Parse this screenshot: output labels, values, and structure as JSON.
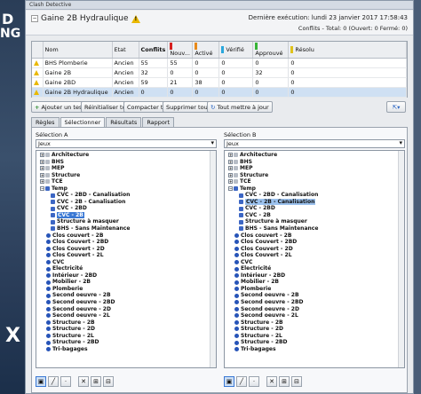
{
  "window": {
    "title": "Clash Detective"
  },
  "background": {
    "left_text_1": "D",
    "left_text_2": "NG",
    "left_text_3": "X"
  },
  "header": {
    "test_name": "Gaine 2B Hydraulique",
    "last_run_label": "Dernière exécution:",
    "last_run_value": "lundi 23 janvier 2017 17:58:43",
    "counts": "Conflits - Total: 0 (Ouvert: 0 Fermé: 0)"
  },
  "grid": {
    "columns": [
      "Nom",
      "Etat",
      "Conflits",
      "Nouv...",
      "Activé",
      "Vérifié",
      "Approuvé",
      "Résolu"
    ],
    "column_colors": [
      "",
      "",
      "",
      "#d62020",
      "#e88a1a",
      "#2aa7dc",
      "#37b437",
      "#e0c21a"
    ],
    "rows": [
      {
        "name": "BHS Plomberie",
        "state": "Ancien",
        "conflicts": "55",
        "new": "55",
        "active": "0",
        "verified": "0",
        "approved": "0",
        "resolved": "0"
      },
      {
        "name": "Gaine 2B",
        "state": "Ancien",
        "conflicts": "32",
        "new": "0",
        "active": "0",
        "verified": "0",
        "approved": "32",
        "resolved": "0"
      },
      {
        "name": "Gaine 2BD",
        "state": "Ancien",
        "conflicts": "59",
        "new": "21",
        "active": "38",
        "verified": "0",
        "approved": "0",
        "resolved": "0"
      },
      {
        "name": "Gaine 2B Hydraulique",
        "state": "Ancien",
        "conflicts": "0",
        "new": "0",
        "active": "0",
        "verified": "0",
        "approved": "0",
        "resolved": "0"
      }
    ]
  },
  "buttons": {
    "add_test": "Ajouter un test",
    "reset_all": "Réinitialiser tout",
    "compact_all": "Compacter tout",
    "delete_all": "Supprimer tout",
    "update_all": "Tout mettre à jour"
  },
  "tabs": [
    "Règles",
    "Sélectionner",
    "Résultats",
    "Rapport"
  ],
  "selection_a": {
    "label": "Sélection A",
    "combo": "Jeux",
    "items": [
      {
        "label": "Architecture",
        "indent": 0,
        "type": "folder",
        "state": ""
      },
      {
        "label": "BHS",
        "indent": 0,
        "type": "folder",
        "state": ""
      },
      {
        "label": "MEP",
        "indent": 0,
        "type": "folder",
        "state": ""
      },
      {
        "label": "Structure",
        "indent": 0,
        "type": "folder",
        "state": ""
      },
      {
        "label": "TCE",
        "indent": 0,
        "type": "folder",
        "state": ""
      },
      {
        "label": "Temp",
        "indent": 0,
        "type": "set",
        "state": ""
      },
      {
        "label": "CVC - 2BD - Canalisation",
        "indent": 1,
        "type": "set",
        "state": ""
      },
      {
        "label": "CVC - 2B - Canalisation",
        "indent": 1,
        "type": "set",
        "state": ""
      },
      {
        "label": "CVC - 2BD",
        "indent": 1,
        "type": "set",
        "state": ""
      },
      {
        "label": "CVC - 2B",
        "indent": 1,
        "type": "set",
        "state": "selected"
      },
      {
        "label": "Structure à masquer",
        "indent": 1,
        "type": "set",
        "state": ""
      },
      {
        "label": "BHS - Sans Maintenance",
        "indent": 1,
        "type": "set",
        "state": ""
      },
      {
        "label": "Clos couvert - 2B",
        "indent": 0,
        "type": "dot",
        "state": ""
      },
      {
        "label": "Clos Couvert - 2BD",
        "indent": 0,
        "type": "dot",
        "state": ""
      },
      {
        "label": "Clos Couvert - 2D",
        "indent": 0,
        "type": "dot",
        "state": ""
      },
      {
        "label": "Clos Couvert - 2L",
        "indent": 0,
        "type": "dot",
        "state": ""
      },
      {
        "label": "CVC",
        "indent": 0,
        "type": "dot",
        "state": ""
      },
      {
        "label": "Electricité",
        "indent": 0,
        "type": "dot",
        "state": ""
      },
      {
        "label": "Intérieur - 2BD",
        "indent": 0,
        "type": "dot",
        "state": ""
      },
      {
        "label": "Mobilier - 2B",
        "indent": 0,
        "type": "dot",
        "state": ""
      },
      {
        "label": "Plomberie",
        "indent": 0,
        "type": "dot",
        "state": ""
      },
      {
        "label": "Second oeuvre - 2B",
        "indent": 0,
        "type": "dot",
        "state": ""
      },
      {
        "label": "Second oeuvre - 2BD",
        "indent": 0,
        "type": "dot",
        "state": ""
      },
      {
        "label": "Second oeuvre - 2D",
        "indent": 0,
        "type": "dot",
        "state": ""
      },
      {
        "label": "Second oeuvre - 2L",
        "indent": 0,
        "type": "dot",
        "state": ""
      },
      {
        "label": "Structure - 2B",
        "indent": 0,
        "type": "dot",
        "state": ""
      },
      {
        "label": "Structure - 2D",
        "indent": 0,
        "type": "dot",
        "state": ""
      },
      {
        "label": "Structure - 2L",
        "indent": 0,
        "type": "dot",
        "state": ""
      },
      {
        "label": "Structure - 2BD",
        "indent": 0,
        "type": "dot",
        "state": ""
      },
      {
        "label": "Tri-bagages",
        "indent": 0,
        "type": "dot",
        "state": ""
      }
    ]
  },
  "selection_b": {
    "label": "Sélection B",
    "combo": "Jeux",
    "items": [
      {
        "label": "Architecture",
        "indent": 0,
        "type": "folder",
        "state": ""
      },
      {
        "label": "BHS",
        "indent": 0,
        "type": "folder",
        "state": ""
      },
      {
        "label": "MEP",
        "indent": 0,
        "type": "folder",
        "state": ""
      },
      {
        "label": "Structure",
        "indent": 0,
        "type": "folder",
        "state": ""
      },
      {
        "label": "TCE",
        "indent": 0,
        "type": "folder",
        "state": ""
      },
      {
        "label": "Temp",
        "indent": 0,
        "type": "set",
        "state": ""
      },
      {
        "label": "CVC - 2BD - Canalisation",
        "indent": 1,
        "type": "set",
        "state": ""
      },
      {
        "label": "CVC - 2B - Canalisation",
        "indent": 1,
        "type": "set",
        "state": "selected"
      },
      {
        "label": "CVC - 2BD",
        "indent": 1,
        "type": "set",
        "state": ""
      },
      {
        "label": "CVC - 2B",
        "indent": 1,
        "type": "set",
        "state": ""
      },
      {
        "label": "Structure à masquer",
        "indent": 1,
        "type": "set",
        "state": ""
      },
      {
        "label": "BHS - Sans Maintenance",
        "indent": 1,
        "type": "set",
        "state": ""
      },
      {
        "label": "Clos couvert - 2B",
        "indent": 0,
        "type": "dot",
        "state": ""
      },
      {
        "label": "Clos Couvert - 2BD",
        "indent": 0,
        "type": "dot",
        "state": ""
      },
      {
        "label": "Clos Couvert - 2D",
        "indent": 0,
        "type": "dot",
        "state": ""
      },
      {
        "label": "Clos Couvert - 2L",
        "indent": 0,
        "type": "dot",
        "state": ""
      },
      {
        "label": "CVC",
        "indent": 0,
        "type": "dot",
        "state": ""
      },
      {
        "label": "Electricité",
        "indent": 0,
        "type": "dot",
        "state": ""
      },
      {
        "label": "Intérieur - 2BD",
        "indent": 0,
        "type": "dot",
        "state": ""
      },
      {
        "label": "Mobilier - 2B",
        "indent": 0,
        "type": "dot",
        "state": ""
      },
      {
        "label": "Plomberie",
        "indent": 0,
        "type": "dot",
        "state": ""
      },
      {
        "label": "Second oeuvre - 2B",
        "indent": 0,
        "type": "dot",
        "state": ""
      },
      {
        "label": "Second oeuvre - 2BD",
        "indent": 0,
        "type": "dot",
        "state": ""
      },
      {
        "label": "Second oeuvre - 2D",
        "indent": 0,
        "type": "dot",
        "state": ""
      },
      {
        "label": "Second oeuvre - 2L",
        "indent": 0,
        "type": "dot",
        "state": ""
      },
      {
        "label": "Structure - 2B",
        "indent": 0,
        "type": "dot",
        "state": ""
      },
      {
        "label": "Structure - 2D",
        "indent": 0,
        "type": "dot",
        "state": ""
      },
      {
        "label": "Structure - 2L",
        "indent": 0,
        "type": "dot",
        "state": ""
      },
      {
        "label": "Structure - 2BD",
        "indent": 0,
        "type": "dot",
        "state": ""
      },
      {
        "label": "Tri-bagages",
        "indent": 0,
        "type": "dot",
        "state": ""
      }
    ]
  },
  "icons": {
    "warning": "warning-icon",
    "set": "selection-set-icon",
    "folder": "folder-icon"
  }
}
